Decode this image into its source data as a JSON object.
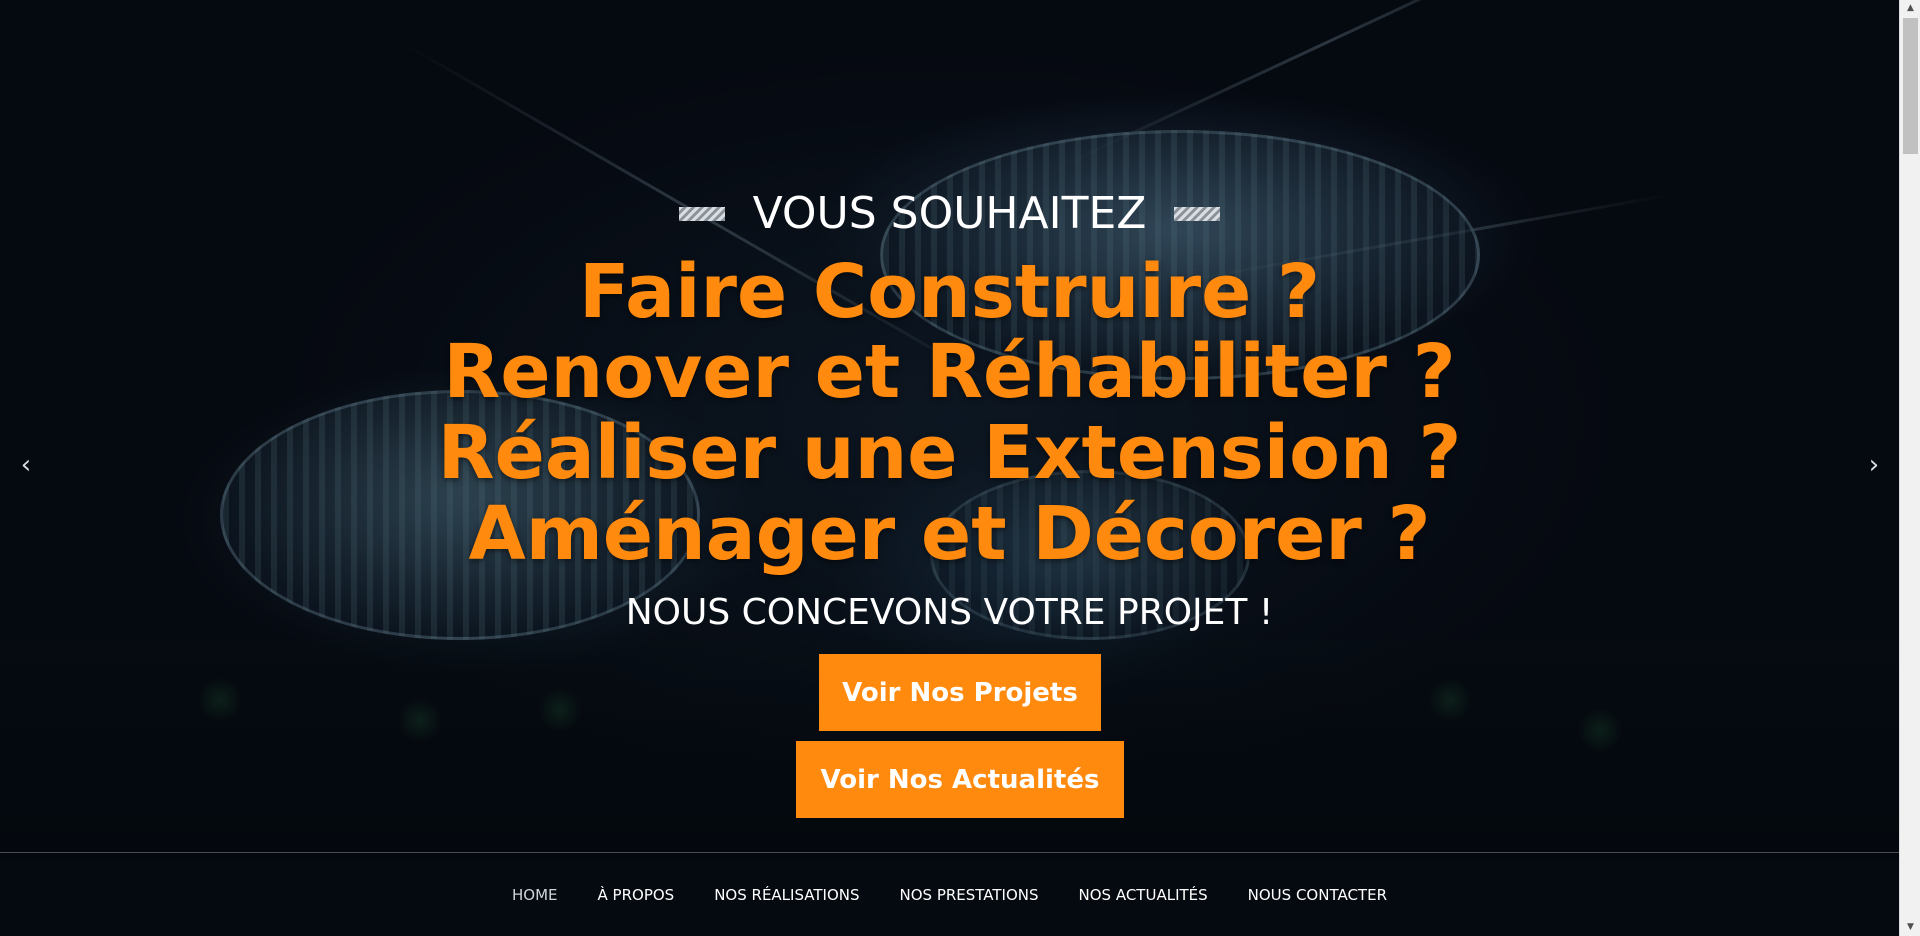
{
  "hero": {
    "eyebrow": "VOUS SOUHAITEZ",
    "headlines": [
      "Faire Construire ?",
      "Renover et Réhabiliter ?",
      "Réaliser une Extension ?",
      "Aménager et Décorer ?"
    ],
    "tagline": "NOUS CONCEVONS VOTRE PROJET !",
    "buttons": {
      "projects": "Voir Nos Projets",
      "news": "Voir Nos Actualités"
    },
    "arrows": {
      "prev": "‹",
      "next": "›"
    }
  },
  "nav": {
    "items": [
      {
        "label": "HOME",
        "active": true
      },
      {
        "label": "À PROPOS"
      },
      {
        "label": "NOS RÉALISATIONS"
      },
      {
        "label": "NOS PRESTATIONS"
      },
      {
        "label": "NOS ACTUALITÉS"
      },
      {
        "label": "NOUS CONTACTER"
      }
    ]
  },
  "scrollbar": {
    "up": "▲",
    "down": "▼"
  },
  "colors": {
    "accent": "#ff8a0d",
    "text": "#ffffff",
    "background": "#05080f"
  },
  "icons": {
    "prev": "chevron-left-icon",
    "next": "chevron-right-icon"
  }
}
